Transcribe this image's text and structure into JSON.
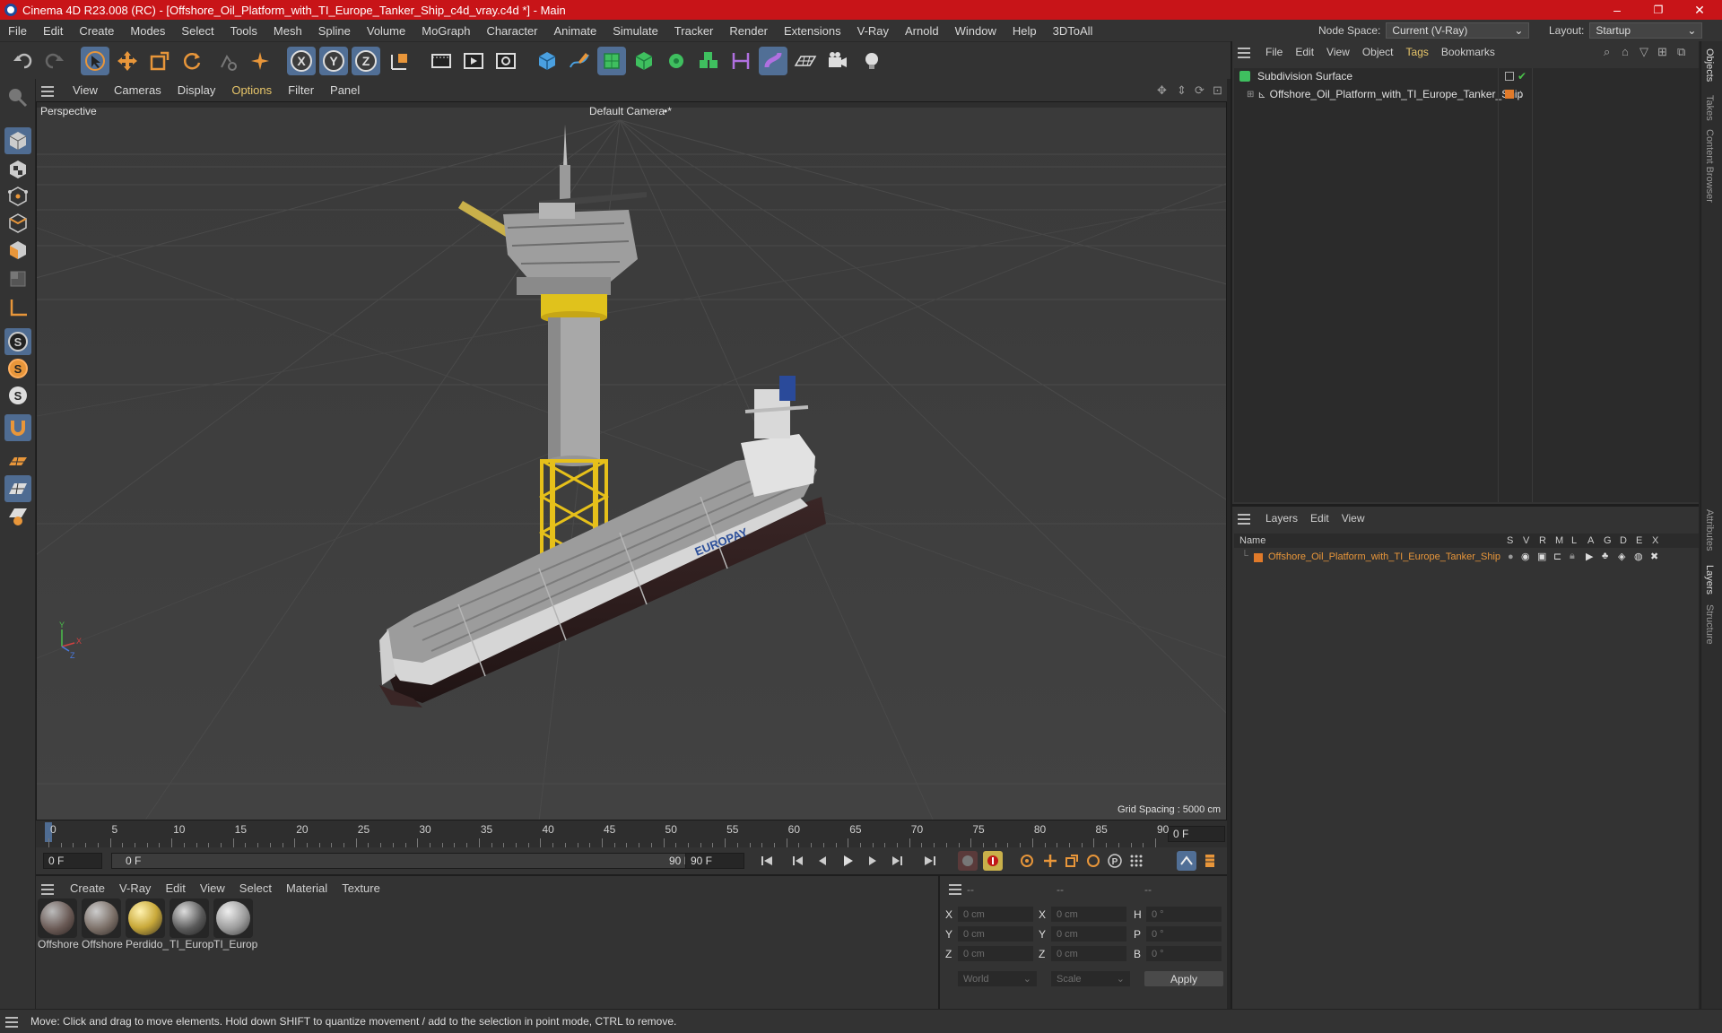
{
  "window": {
    "title": "Cinema 4D R23.008 (RC) - [Offshore_Oil_Platform_with_TI_Europe_Tanker_Ship_c4d_vray.c4d *] - Main",
    "minimize": "–",
    "maximize": "❐",
    "close": "✕"
  },
  "menubar": {
    "items": [
      "File",
      "Edit",
      "Create",
      "Modes",
      "Select",
      "Tools",
      "Mesh",
      "Spline",
      "Volume",
      "MoGraph",
      "Character",
      "Animate",
      "Simulate",
      "Tracker",
      "Render",
      "Extensions",
      "V-Ray",
      "Arnold",
      "Window",
      "Help",
      "3DToAll"
    ],
    "node_space_label": "Node Space:",
    "node_space_value": "Current (V-Ray)",
    "layout_label": "Layout:",
    "layout_value": "Startup"
  },
  "toolbar": {
    "icons": [
      "undo-icon",
      "redo-icon",
      "live-selection-icon",
      "move-icon",
      "scale-icon",
      "rotate-icon",
      "recent-tools-icon",
      "create-object-icon",
      "axis-x-icon",
      "axis-y-icon",
      "axis-z-icon",
      "coordinate-system-icon",
      "render-region-icon",
      "render-view-icon",
      "render-settings-icon",
      "cube-icon",
      "pen-icon",
      "subdivision-icon",
      "extrude-icon",
      "cloner-icon",
      "array-icon",
      "deformer-icon",
      "scene-icon",
      "floor-icon",
      "camera-icon",
      "light-icon"
    ],
    "axis_labels": [
      "X",
      "Y",
      "Z"
    ]
  },
  "left_tools": {
    "icons": [
      "make-editable-icon",
      "model-mode-icon",
      "texture-mode-icon",
      "points-mode-icon",
      "edges-mode-icon",
      "polygons-mode-icon",
      "uvw-mode-icon",
      "axis-mode-icon",
      "snap-s-icon",
      "snap-s-orange-icon",
      "snap-s-white-icon",
      "magnet-icon",
      "workplane-icon",
      "grid-icon",
      "locked-workplane-icon"
    ],
    "snap_letter": "S"
  },
  "viewport": {
    "menu": [
      "View",
      "Cameras",
      "Display",
      "Options",
      "Filter",
      "Panel"
    ],
    "label_left": "Perspective",
    "label_center": "Default Camera",
    "camera_marker": "•*",
    "grid_spacing": "Grid Spacing : 5000 cm",
    "hull_text": "EUROPAY",
    "axes": {
      "x": "X",
      "y": "Y",
      "z": "Z"
    }
  },
  "timeline": {
    "ticks": [
      "0",
      "5",
      "10",
      "15",
      "20",
      "25",
      "30",
      "35",
      "40",
      "45",
      "50",
      "55",
      "60",
      "65",
      "70",
      "75",
      "80",
      "85",
      "90"
    ],
    "current_frame": "0 F"
  },
  "transport": {
    "start_frame": "0 F",
    "range_start": "0 F",
    "range_end": "90 F",
    "end_frame": "90 F",
    "buttons": [
      "go-start-icon",
      "prev-key-icon",
      "prev-frame-icon",
      "play-icon",
      "next-frame-icon",
      "next-key-icon",
      "go-end-icon"
    ],
    "record_buttons": [
      "record-icon",
      "autokey-icon",
      "keyframe-icon",
      "move-key-icon",
      "scale-key-icon",
      "rotate-key-icon",
      "param-key-icon",
      "pla-key-icon"
    ],
    "param_letter": "P"
  },
  "material_manager": {
    "menu": [
      "Create",
      "V-Ray",
      "Edit",
      "View",
      "Select",
      "Material",
      "Texture"
    ],
    "materials": [
      {
        "name": "Offshore",
        "color": "#6a5a55"
      },
      {
        "name": "Offshore",
        "color": "#7b6f67"
      },
      {
        "name": "Perdido_",
        "color": "#c9a93a"
      },
      {
        "name": "TI_Europ",
        "color": "#5a5a5a"
      },
      {
        "name": "TI_Europ",
        "color": "#9a9a9a"
      }
    ]
  },
  "coordinates": {
    "headers": [
      "--",
      "--",
      "--"
    ],
    "rows": [
      {
        "a": "X",
        "av": "0 cm",
        "b": "X",
        "bv": "0 cm",
        "c": "H",
        "cv": "0 °"
      },
      {
        "a": "Y",
        "av": "0 cm",
        "b": "Y",
        "bv": "0 cm",
        "c": "P",
        "cv": "0 °"
      },
      {
        "a": "Z",
        "av": "0 cm",
        "b": "Z",
        "bv": "0 cm",
        "c": "B",
        "cv": "0 °"
      }
    ],
    "world": "World",
    "scale": "Scale",
    "apply": "Apply"
  },
  "object_manager": {
    "menu": [
      "File",
      "Edit",
      "View",
      "Object",
      "Tags",
      "Bookmarks"
    ],
    "objects": [
      {
        "name": "Subdivision Surface",
        "indent": 0
      },
      {
        "name": "Offshore_Oil_Platform_with_TI_Europe_Tanker_Ship",
        "indent": 1
      }
    ]
  },
  "layers": {
    "menu": [
      "Layers",
      "Edit",
      "View"
    ],
    "name_header": "Name",
    "flag_headers": [
      "S",
      "V",
      "R",
      "M",
      "L",
      "A",
      "G",
      "D",
      "E",
      "X"
    ],
    "rows": [
      {
        "name": "Offshore_Oil_Platform_with_TI_Europe_Tanker_Ship",
        "color": "#e07a2a"
      }
    ]
  },
  "side_tabs": [
    "Objects",
    "Takes",
    "Content Browser",
    "Attributes",
    "Layers",
    "Structure"
  ],
  "status": {
    "text": "Move: Click and drag to move elements. Hold down SHIFT to quantize movement / add to the selection in point mode, CTRL to remove."
  },
  "colors": {
    "accent": "#4f6c92",
    "title_bar": "#c81418",
    "highlight_orange": "#e8963a"
  }
}
